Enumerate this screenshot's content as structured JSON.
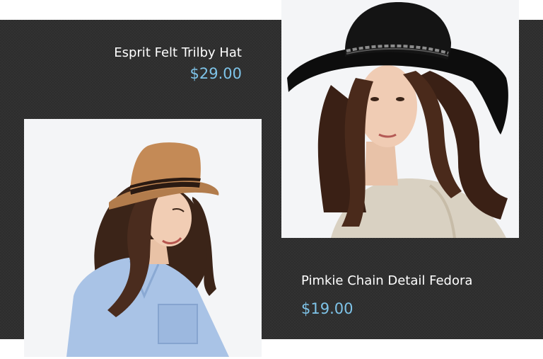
{
  "products": [
    {
      "name": "Esprit Felt Trilby Hat",
      "price": "$29.00",
      "image_subject": "woman in tan felt trilby hat with black band and light blue shirt"
    },
    {
      "name": "Pimkie Chain Detail Fedora",
      "price": "$19.00",
      "image_subject": "woman in wide-brim black felt fedora with chain band and cream knit cardigan"
    }
  ],
  "colors": {
    "background": "#2d2d2d",
    "price": "#7ec3e8",
    "title": "#ffffff"
  }
}
